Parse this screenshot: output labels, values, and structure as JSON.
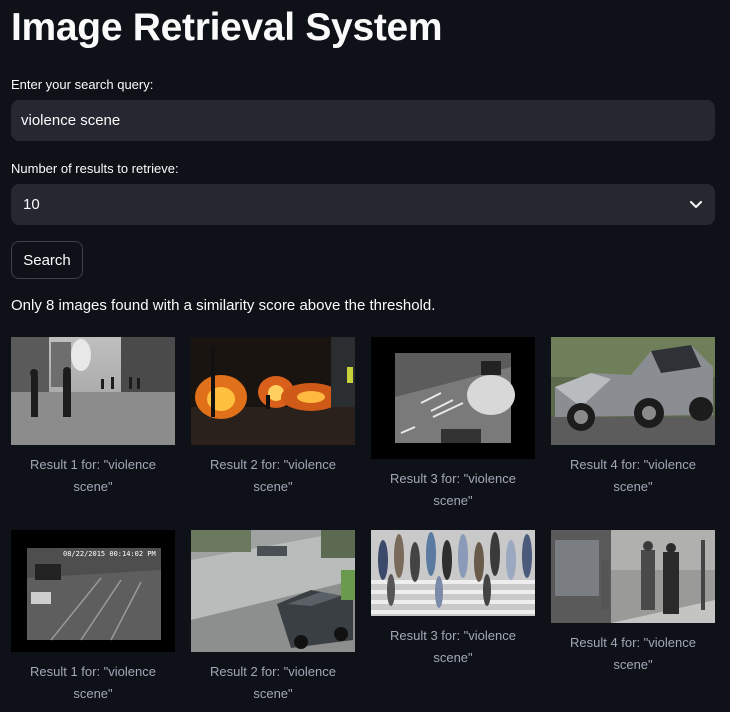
{
  "title": "Image Retrieval System",
  "query_label": "Enter your search query:",
  "query_value": "violence scene",
  "count_label": "Number of results to retrieve:",
  "count_value": "10",
  "search_button": "Search",
  "status_message": "Only 8 images found with a similarity score above the threshold.",
  "results": [
    {
      "caption_line1": "Result 1 for: \"violence",
      "caption_line2": "scene\"",
      "image": "grayscale street protest with police"
    },
    {
      "caption_line1": "Result 2 for: \"violence",
      "caption_line2": "scene\"",
      "image": "street fire riot at night"
    },
    {
      "caption_line1": "Result 3 for: \"violence",
      "caption_line2": "scene\"",
      "image": "surveillance camera night road"
    },
    {
      "caption_line1": "Result 4 for: \"violence",
      "caption_line2": "scene\"",
      "image": "crashed car wreck"
    },
    {
      "caption_line1": "Result 1 for: \"violence",
      "caption_line2": "scene\"",
      "image": "cctv parking lot footage",
      "timestamp": "08/22/2015 00:14:02 PM"
    },
    {
      "caption_line1": "Result 2 for: \"violence",
      "caption_line2": "scene\"",
      "image": "cctv street intersection with parked car"
    },
    {
      "caption_line1": "Result 3 for: \"violence",
      "caption_line2": "scene\"",
      "image": "crowd crossing street crosswalk"
    },
    {
      "caption_line1": "Result 4 for: \"violence",
      "caption_line2": "scene\"",
      "image": "cctv sidewalk people walking"
    }
  ]
}
